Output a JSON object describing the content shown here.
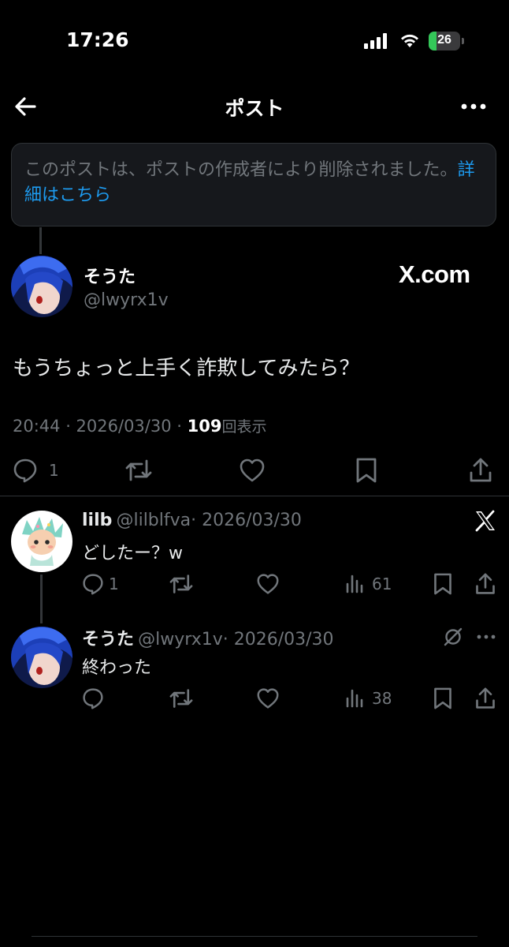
{
  "status_bar": {
    "time": "17:26",
    "battery": "26",
    "battery_level": 0.26
  },
  "header": {
    "title": "ポスト"
  },
  "notice": {
    "text": "このポストは、ポストの作成者により削除されました。",
    "link": "詳細はこちら"
  },
  "main_post": {
    "name": "そうた",
    "handle": "@lwyrx1v",
    "watermark": "X.com",
    "text": "もうちょっと上手く詐欺してみたら？",
    "timestamp": "20:44 · 2026/03/30 · ",
    "views": "109",
    "views_label": "回表示",
    "reply_count": "1"
  },
  "replies": [
    {
      "name": "lilb",
      "handle": "@lilblfva",
      "date": "· 2026/03/30",
      "text": "どしたー？w",
      "reply_count": "1",
      "views": "61"
    },
    {
      "name": "そうた",
      "handle": "@lwyrx1v",
      "date": "· 2026/03/30",
      "text": "終わった",
      "views": "38"
    }
  ],
  "colors": {
    "background": "#000000",
    "accent": "#1d9bf0",
    "secondary_text": "#71767b",
    "battery": "#34c759"
  }
}
